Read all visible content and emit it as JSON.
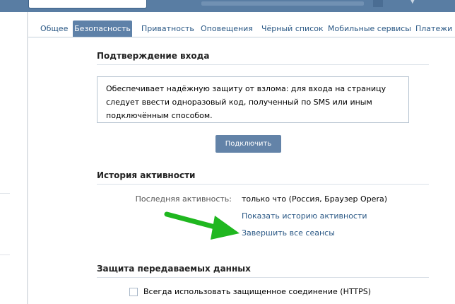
{
  "tabs": [
    {
      "label": "Общее"
    },
    {
      "label": "Безопасность",
      "active": true
    },
    {
      "label": "Приватность"
    },
    {
      "label": "Оповещения"
    },
    {
      "label": "Чёрный список"
    },
    {
      "label": "Мобильные сервисы"
    },
    {
      "label": "Платежи"
    }
  ],
  "login_confirmation": {
    "title": "Подтверждение входа",
    "description": "Обеспечивает надёжную защиту от взлома: для входа на страницу следует ввести одноразовый код, полученный по SMS или иным подключённым способом.",
    "connect_button": "Подключить"
  },
  "activity_history": {
    "title": "История активности",
    "last_activity_label": "Последняя активность:",
    "last_activity_value": "только что (Россия, Браузер Opera)",
    "show_history_link": "Показать историю активности",
    "end_sessions_link": "Завершить все сеансы"
  },
  "data_protection": {
    "title": "Защита передаваемых данных",
    "https_checkbox_label": "Всегда использовать защищенное соединение (HTTPS)",
    "https_checked": false
  },
  "colors": {
    "header_blue": "#597da3",
    "active_tab": "#5e81a8",
    "link": "#2a5885",
    "button": "#6383a8",
    "annotation_arrow": "#1fb71f"
  }
}
